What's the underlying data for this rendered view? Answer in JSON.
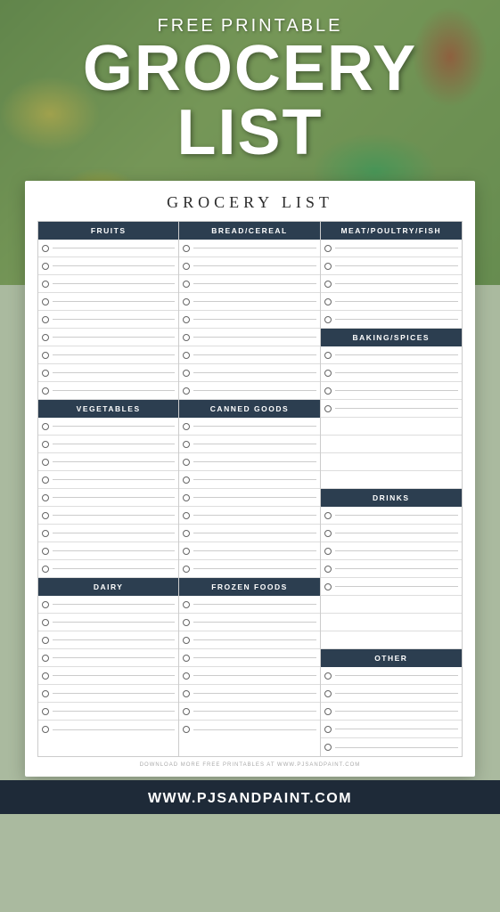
{
  "header": {
    "free_label": "FREE",
    "printable_label": "PRINTABLE",
    "grocery_label": "GROCERY",
    "list_label": "LIST"
  },
  "paper": {
    "title": "GROCERY LIST",
    "sections": {
      "fruits": {
        "label": "FRUITS",
        "rows": 9
      },
      "bread": {
        "label": "BREAD/CEREAL",
        "rows": 9
      },
      "meat": {
        "label": "MEAT/POULTRY/FISH",
        "rows": 5
      },
      "baking": {
        "label": "BAKING/SPICES",
        "rows": 4
      },
      "vegetables": {
        "label": "VEGETABLES",
        "rows": 9
      },
      "canned": {
        "label": "CANNED GOODS",
        "rows": 9
      },
      "drinks": {
        "label": "DRINKS",
        "rows": 5
      },
      "dairy": {
        "label": "DAIRY",
        "rows": 8
      },
      "frozen": {
        "label": "FROZEN FOODS",
        "rows": 8
      },
      "other": {
        "label": "OTHER",
        "rows": 5
      }
    },
    "footer_text": "DOWNLOAD MORE FREE PRINTABLES AT WWW.PJSANDPAINT.COM"
  },
  "footer": {
    "url": "WWW.PJSANDPAINT.COM"
  }
}
